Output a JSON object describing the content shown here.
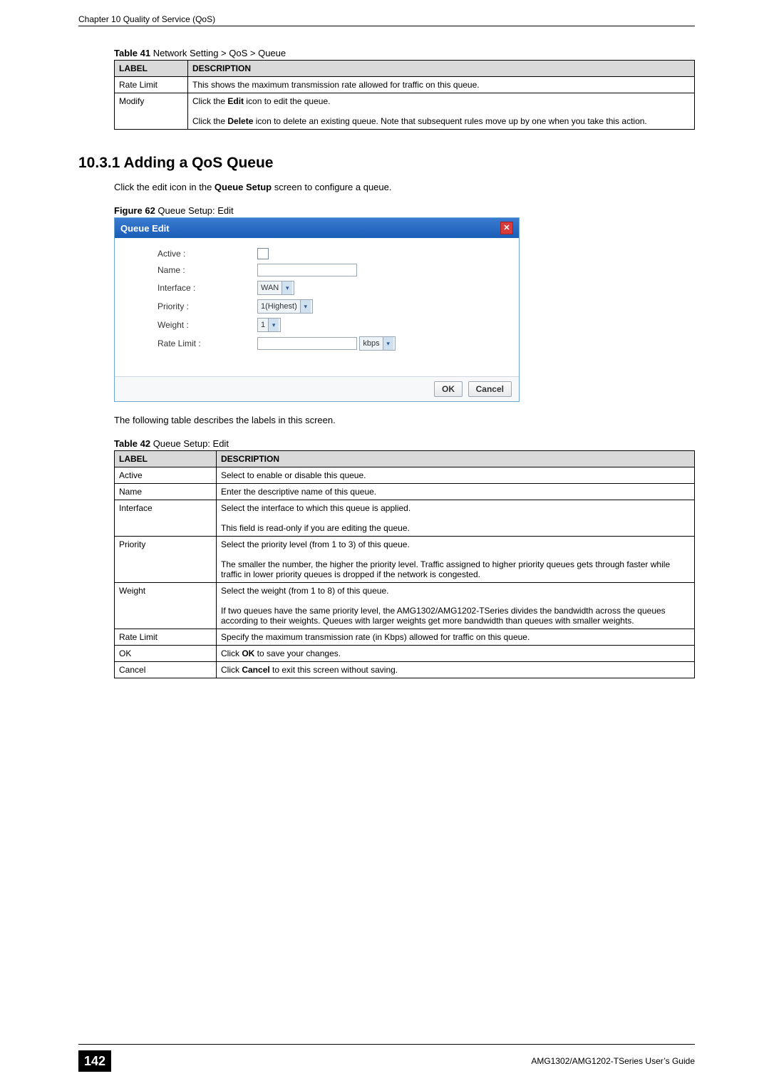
{
  "header": {
    "chapter_line": "Chapter 10 Quality of Service (QoS)"
  },
  "table41": {
    "caption_prefix": "Table 41   ",
    "caption_text": "Network Setting > QoS > Queue",
    "headers": {
      "label": "LABEL",
      "description": "DESCRIPTION"
    },
    "rows": [
      {
        "label": "Rate Limit",
        "desc": "This shows the maximum transmission rate allowed for traffic on this queue."
      },
      {
        "label": "Modify",
        "desc_line1_pre": "Click the ",
        "desc_line1_bold": "Edit",
        "desc_line1_post": " icon to edit the queue.",
        "desc_line2_pre": "Click the ",
        "desc_line2_bold": "Delete",
        "desc_line2_post": " icon to delete an existing queue. Note that subsequent rules move up by one when you take this action."
      }
    ]
  },
  "section": {
    "heading": "10.3.1  Adding a QoS Queue",
    "intro_pre": "Click the edit icon in the ",
    "intro_bold": "Queue Setup",
    "intro_post": " screen to configure a queue."
  },
  "figure62": {
    "caption_prefix": "Figure 62   ",
    "caption_text": "Queue Setup: Edit",
    "dialog_title": "Queue Edit",
    "fields": {
      "active": "Active :",
      "name": "Name :",
      "interface": "Interface :",
      "priority": "Priority :",
      "weight": "Weight :",
      "rate_limit": "Rate Limit :"
    },
    "values": {
      "interface": "WAN",
      "priority": "1(Highest)",
      "weight": "1",
      "rate_unit": "kbps"
    },
    "buttons": {
      "ok": "OK",
      "cancel": "Cancel"
    },
    "close_icon": "✕"
  },
  "para_after_figure": "The following table describes the labels in this screen.",
  "table42": {
    "caption_prefix": "Table 42   ",
    "caption_text": "Queue Setup: Edit",
    "headers": {
      "label": "LABEL",
      "description": "DESCRIPTION"
    },
    "rows": [
      {
        "label": "Active",
        "desc": "Select to enable or disable this queue."
      },
      {
        "label": "Name",
        "desc": "Enter the descriptive name of this queue."
      },
      {
        "label": "Interface",
        "desc_line1": "Select the interface to which this queue is applied.",
        "desc_line2": "This field is read-only if you are editing the queue."
      },
      {
        "label": "Priority",
        "desc_line1": "Select the priority level (from 1 to 3) of this queue.",
        "desc_line2": "The smaller the number, the higher the priority level. Traffic assigned to higher priority queues gets through faster while traffic in lower priority queues is dropped if the network is congested."
      },
      {
        "label": "Weight",
        "desc_line1": "Select the weight (from 1 to 8) of this queue.",
        "desc_line2": "If two queues have the same priority level, the AMG1302/AMG1202-TSeries divides the bandwidth across the queues according to their weights. Queues with larger weights get more bandwidth than queues with smaller weights."
      },
      {
        "label": "Rate Limit",
        "desc": "Specify the maximum transmission rate (in Kbps) allowed for traffic on this queue."
      },
      {
        "label": "OK",
        "desc_pre": "Click ",
        "desc_bold": "OK",
        "desc_post": " to save your changes."
      },
      {
        "label": "Cancel",
        "desc_pre": "Click ",
        "desc_bold": "Cancel",
        "desc_post": " to exit this screen without saving."
      }
    ]
  },
  "footer": {
    "page_number": "142",
    "guide": "AMG1302/AMG1202-TSeries User’s Guide"
  }
}
